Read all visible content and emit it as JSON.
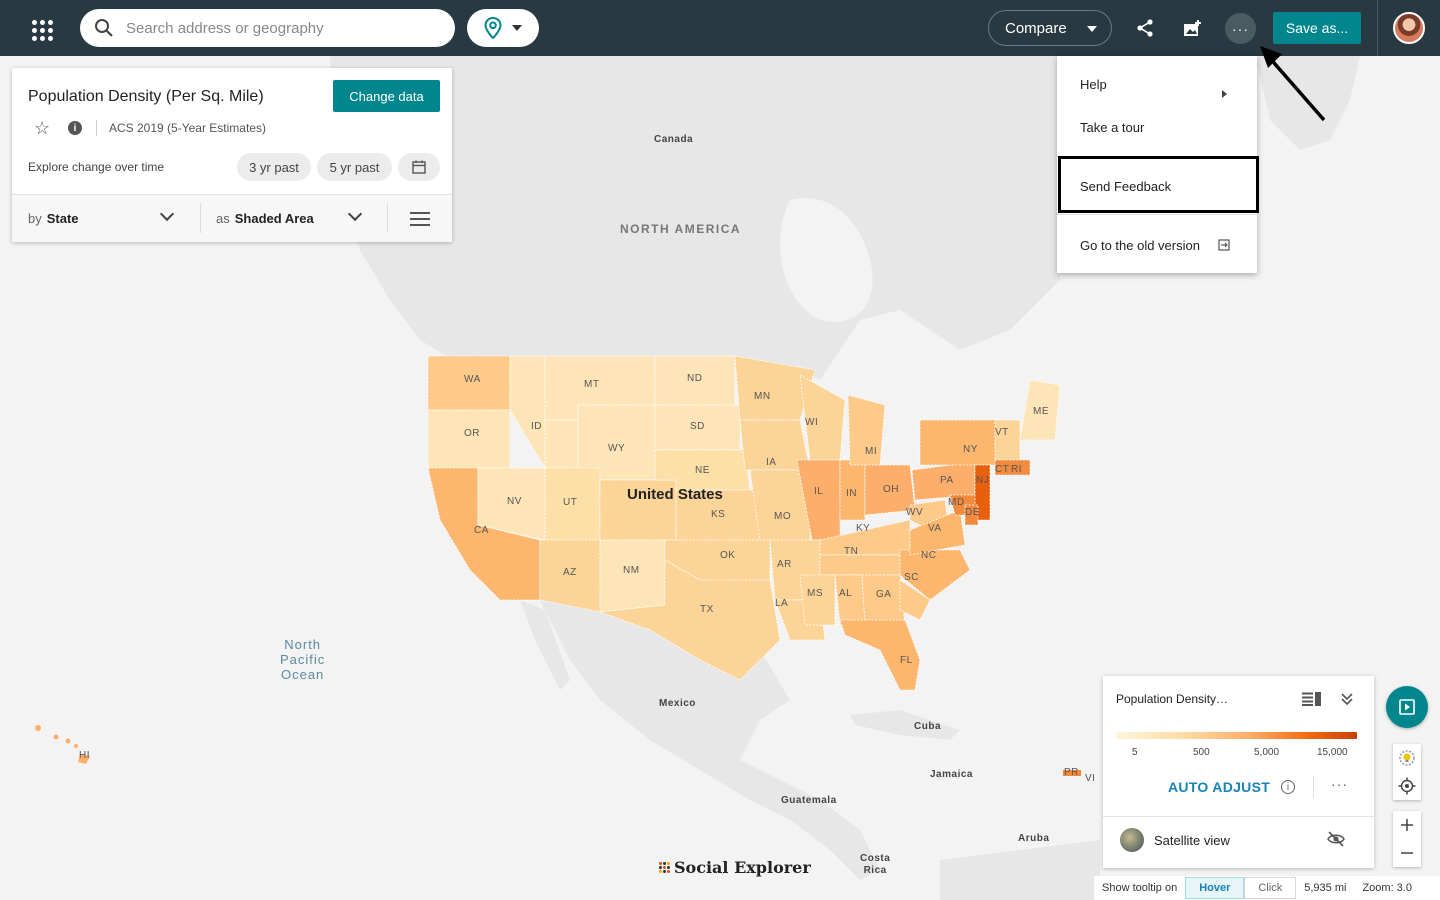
{
  "topbar": {
    "search_placeholder": "Search address or geography",
    "compare_label": "Compare",
    "more_label": "···",
    "save_label": "Save as..."
  },
  "panel": {
    "title": "Population Density (Per Sq. Mile)",
    "change_data_label": "Change data",
    "dataset": "ACS 2019 (5-Year Estimates)",
    "explore_label": "Explore change over time",
    "pill_3yr": "3 yr past",
    "pill_5yr": "5 yr past",
    "by_prefix": "by",
    "by_value": "State",
    "as_prefix": "as",
    "as_value": "Shaded Area"
  },
  "menu": {
    "items": [
      {
        "label": "Help"
      },
      {
        "label": "Take a tour"
      },
      {
        "label": "Send Feedback"
      },
      {
        "label": "Go to the old version"
      }
    ]
  },
  "map": {
    "labels": {
      "canada": "Canada",
      "north_america": "NORTH AMERICA",
      "united_states": "United States",
      "mexico": "Mexico",
      "cuba": "Cuba",
      "jamaica": "Jamaica",
      "guatemala": "Guatemala",
      "costa_rica": "Costa\nRica",
      "aruba": "Aruba",
      "ocean": "North\nPacific\nOcean",
      "pr": "PR",
      "vi": "VI",
      "hi": "HI"
    },
    "states": [
      "WA",
      "MT",
      "ND",
      "MN",
      "ME",
      "OR",
      "ID",
      "SD",
      "WI",
      "VT",
      "WY",
      "MI",
      "NY",
      "IA",
      "NE",
      "CT",
      "RI",
      "NV",
      "UT",
      "IL",
      "IN",
      "OH",
      "PA",
      "NJ",
      "MD",
      "DE",
      "KS",
      "WV",
      "MO",
      "KY",
      "VA",
      "CA",
      "OK",
      "TN",
      "NC",
      "AZ",
      "NM",
      "AR",
      "SC",
      "MS",
      "AL",
      "GA",
      "TX",
      "LA",
      "FL"
    ],
    "colors": {
      "low": "#fee5b8",
      "mid": "#fdca8a",
      "high": "#fdae6b",
      "vhigh": "#f16913"
    }
  },
  "legend": {
    "title": "Population Density…",
    "ticks": [
      "5",
      "500",
      "5,000",
      "15,000"
    ],
    "auto_adjust": "AUTO ADJUST",
    "satellite": "Satellite view"
  },
  "status": {
    "tooltip_label": "Show tooltip on",
    "hover": "Hover",
    "click": "Click",
    "scale": "5,935 mi",
    "zoom": "Zoom: 3.0"
  },
  "brand": "Social Explorer",
  "colors": {
    "accent": "#00868c",
    "topbar": "#283941",
    "link": "#1783b9"
  }
}
